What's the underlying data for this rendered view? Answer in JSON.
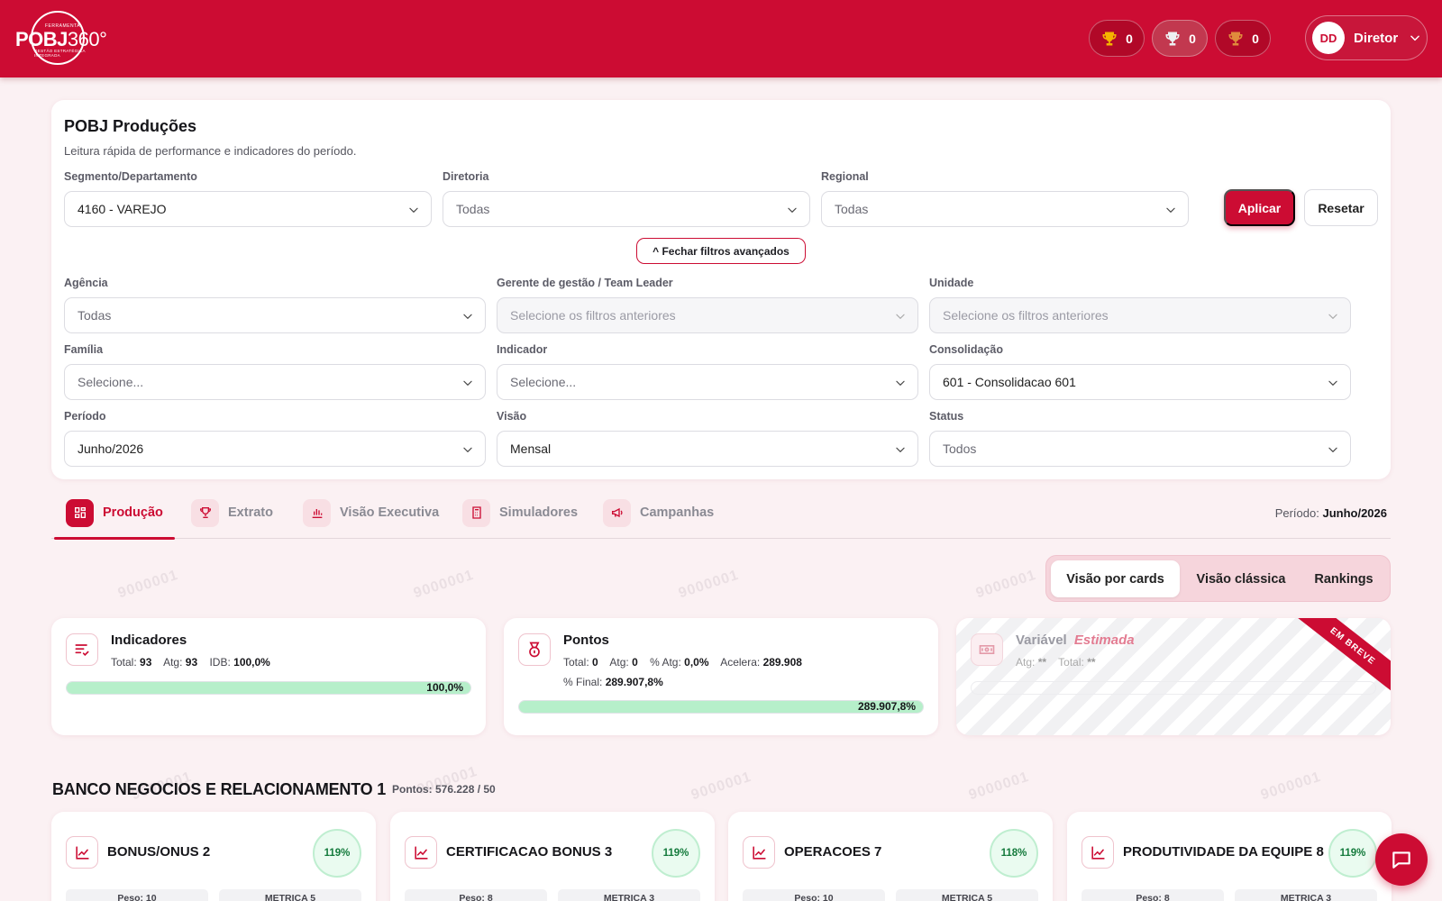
{
  "brand": {
    "top": "FERRAMENTA",
    "name_bold": "POBJ",
    "name_thin": "360°",
    "tagline": "GESTÃO ESTRATÉGICA INTEGRADA"
  },
  "header": {
    "trophies": [
      {
        "icon": "trophy-gold-icon",
        "count": "0"
      },
      {
        "icon": "trophy-silver-icon",
        "count": "0"
      },
      {
        "icon": "trophy-bronze-icon",
        "count": "0"
      }
    ],
    "user": {
      "initials": "DD",
      "name": "Diretor"
    }
  },
  "filters": {
    "title": "POBJ Produções",
    "subtitle": "Leitura rápida de performance e indicadores do período.",
    "segment": {
      "label": "Segmento/Departamento",
      "value": "4160 - VAREJO"
    },
    "diretoria": {
      "label": "Diretoria",
      "value": "Todas"
    },
    "regional": {
      "label": "Regional",
      "value": "Todas"
    },
    "apply": "Aplicar",
    "reset": "Resetar",
    "advanced_toggle": "^ Fechar filtros avançados",
    "agencia": {
      "label": "Agência",
      "value": "Todas"
    },
    "gerente": {
      "label": "Gerente de gestão / Team Leader",
      "value": "Selecione os filtros anteriores"
    },
    "unidade": {
      "label": "Unidade",
      "value": "Selecione os filtros anteriores"
    },
    "familia": {
      "label": "Família",
      "value": "Selecione..."
    },
    "indicador": {
      "label": "Indicador",
      "value": "Selecione..."
    },
    "consolidacao": {
      "label": "Consolidação",
      "value": "601 - Consolidacao 601"
    },
    "periodo": {
      "label": "Período",
      "value": "Junho/2026"
    },
    "visao": {
      "label": "Visão",
      "value": "Mensal"
    },
    "status": {
      "label": "Status",
      "value": "Todos"
    }
  },
  "tabs": [
    {
      "label": "Produção",
      "icon": "dashboard-icon",
      "active": true
    },
    {
      "label": "Extrato",
      "icon": "trophy-icon"
    },
    {
      "label": "Visão Executiva",
      "icon": "bar-chart-icon"
    },
    {
      "label": "Simuladores",
      "icon": "calculator-icon"
    },
    {
      "label": "Campanhas",
      "icon": "megaphone-icon"
    }
  ],
  "period": {
    "label": "Período:",
    "value": "Junho/2026"
  },
  "watermark": "9000001",
  "view_toggle": [
    "Visão por cards",
    "Visão clássica",
    "Rankings"
  ],
  "kpis": {
    "indicadores": {
      "title": "Indicadores",
      "total_label": "Total:",
      "total": "93",
      "atg_label": "Atg:",
      "atg": "93",
      "idb_label": "IDB:",
      "idb": "100,0%",
      "progress": 100,
      "progress_text": "100,0%"
    },
    "pontos": {
      "title": "Pontos",
      "total_label": "Total:",
      "total": "0",
      "atg_label": "Atg:",
      "atg": "0",
      "patg_label": "% Atg:",
      "patg": "0,0%",
      "acelera_label": "Acelera:",
      "acelera": "289.908",
      "final_label": "% Final:",
      "final": "289.907,8%",
      "progress": 100,
      "progress_text": "289.907,8%"
    },
    "variavel": {
      "title": "Variável",
      "title_accent": "Estimada",
      "atg_label": "Atg:",
      "atg": "**",
      "total_label": "Total:",
      "total": "**",
      "ribbon": "EM BREVE"
    }
  },
  "section": {
    "title": "BANCO NEGOCIOS E RELACIONAMENTO 1",
    "points": "Pontos: 576.228 / 50",
    "cards": [
      {
        "name": "BONUS/ONUS 2",
        "pct": "119%",
        "peso": "Peso: 10",
        "metric": "METRICA 5"
      },
      {
        "name": "CERTIFICACAO BONUS 3",
        "pct": "119%",
        "peso": "Peso: 8",
        "metric": "METRICA 3"
      },
      {
        "name": "OPERACOES 7",
        "pct": "118%",
        "peso": "Peso: 10",
        "metric": "METRICA 5"
      },
      {
        "name": "PRODUTIVIDADE DA EQUIPE 8",
        "pct": "119%",
        "peso": "Peso: 8",
        "metric": "METRICA 3"
      }
    ]
  },
  "colors": {
    "brand": "#cc0c33",
    "success": "#b6efca",
    "background": "#fbf1f3"
  }
}
